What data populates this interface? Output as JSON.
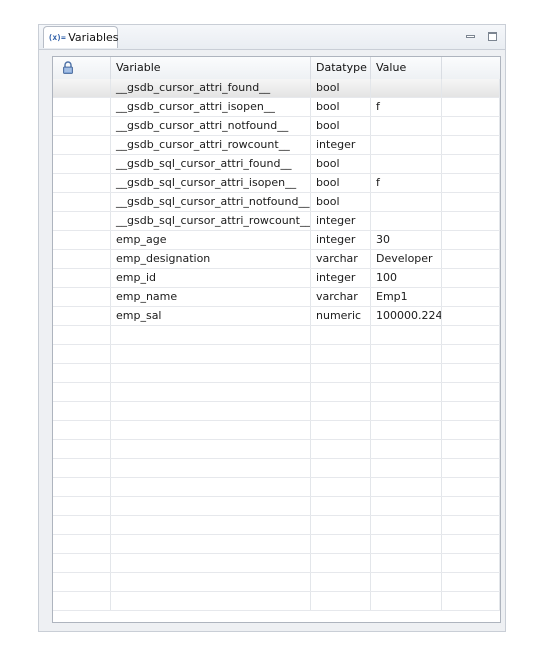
{
  "tab": {
    "icon_text": "(x)=",
    "label": "Variables"
  },
  "window_controls": [
    "minimize-icon",
    "maximize-icon"
  ],
  "table": {
    "lock_column_icon": "lock-icon",
    "columns": [
      "Variable",
      "Datatype",
      "Value"
    ],
    "rows": [
      {
        "variable": "__gsdb_cursor_attri_found__",
        "datatype": "bool",
        "value": ""
      },
      {
        "variable": "__gsdb_cursor_attri_isopen__",
        "datatype": "bool",
        "value": "f"
      },
      {
        "variable": "__gsdb_cursor_attri_notfound__",
        "datatype": "bool",
        "value": ""
      },
      {
        "variable": "__gsdb_cursor_attri_rowcount__",
        "datatype": "integer",
        "value": ""
      },
      {
        "variable": "__gsdb_sql_cursor_attri_found__",
        "datatype": "bool",
        "value": ""
      },
      {
        "variable": "__gsdb_sql_cursor_attri_isopen__",
        "datatype": "bool",
        "value": "f"
      },
      {
        "variable": "__gsdb_sql_cursor_attri_notfound__",
        "datatype": "bool",
        "value": ""
      },
      {
        "variable": "__gsdb_sql_cursor_attri_rowcount__",
        "datatype": "integer",
        "value": ""
      },
      {
        "variable": "emp_age",
        "datatype": "integer",
        "value": "30"
      },
      {
        "variable": "emp_designation",
        "datatype": "varchar",
        "value": "Developer"
      },
      {
        "variable": "emp_id",
        "datatype": "integer",
        "value": "100"
      },
      {
        "variable": "emp_name",
        "datatype": "varchar",
        "value": "Emp1"
      },
      {
        "variable": "emp_sal",
        "datatype": "numeric",
        "value": "100000.224"
      }
    ],
    "selected_row": 0
  }
}
